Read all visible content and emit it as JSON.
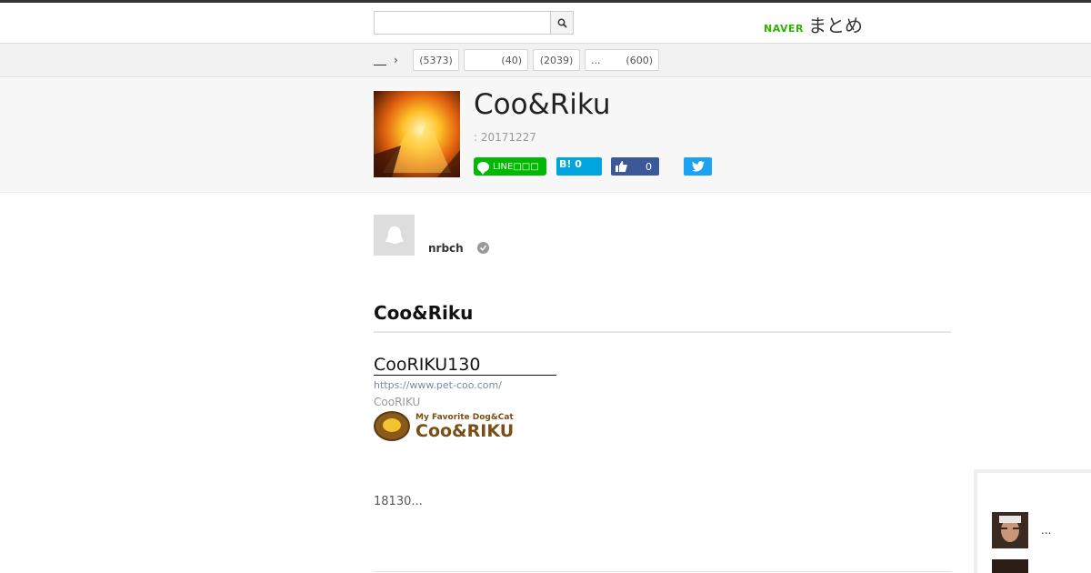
{
  "header": {
    "search_placeholder": "",
    "logo_naver": "NAVER",
    "logo_matome": "まとめ"
  },
  "category_bar": {
    "home_icon": "home-underline-icon",
    "chips": [
      {
        "label": "",
        "count": "(5373)"
      },
      {
        "label": "",
        "count": "(40)"
      },
      {
        "label": "",
        "count": "(2039)"
      },
      {
        "label": "...",
        "count": "(600)"
      }
    ]
  },
  "article": {
    "title": "Coo&Riku",
    "date": ": 20171227",
    "share": {
      "line_label": "LINE□□□",
      "hatena_label": "B! 0",
      "like_count": "0"
    }
  },
  "author": {
    "name": "nrbch"
  },
  "content": {
    "section_heading": "Coo&Riku",
    "link": {
      "title": "CooRIKU130",
      "url": "https://www.pet-coo.com/",
      "site": "CooRIKU"
    },
    "brand": {
      "tagline": "My Favorite Dog&Cat",
      "name": "Coo&RIKU"
    },
    "body_text": "18130..."
  },
  "sidebar": {
    "items": [
      {
        "text": "..."
      },
      {
        "text": ""
      }
    ]
  },
  "colors": {
    "line_green": "#00b900",
    "hatena_blue": "#00a4de",
    "facebook_blue": "#3b5998",
    "twitter_blue": "#1da1f2",
    "naver_green": "#2db400"
  }
}
